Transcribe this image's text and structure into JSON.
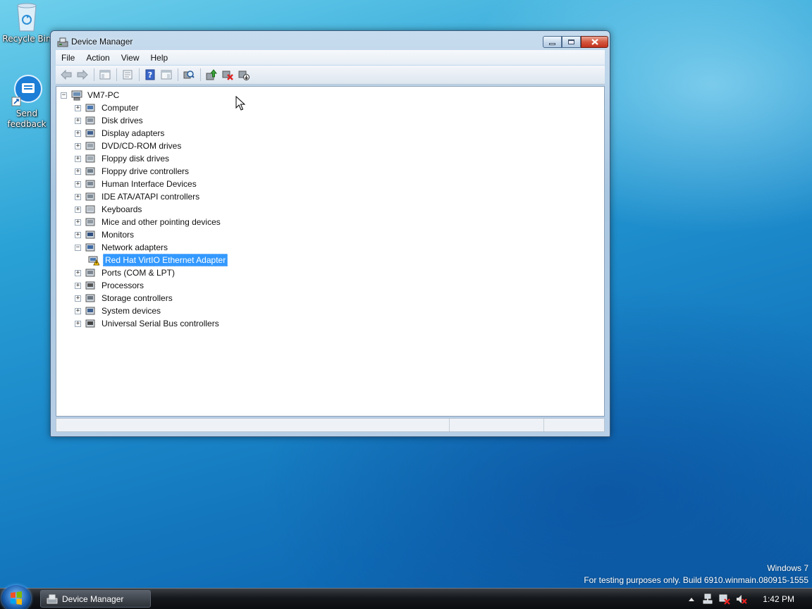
{
  "desktop": {
    "icons": [
      {
        "label": "Recycle Bin"
      },
      {
        "label": "Send feedback"
      }
    ],
    "watermark": {
      "line1": "Windows 7",
      "line2": "For testing purposes only. Build 6910.winmain.080915-1555"
    }
  },
  "window": {
    "title": "Device Manager",
    "menu": [
      "File",
      "Action",
      "View",
      "Help"
    ],
    "toolbar": [
      "back-icon",
      "forward-icon",
      "show-hide-tree-icon",
      "properties-icon",
      "help-icon",
      "show-hide-action-pane-icon",
      "scan-hardware-icon",
      "update-driver-icon",
      "uninstall-icon",
      "disable-device-icon"
    ],
    "tree": {
      "root": "VM7-PC",
      "items": [
        {
          "label": "Computer",
          "icon": "computer-icon",
          "expanded": false
        },
        {
          "label": "Disk drives",
          "icon": "disk-drive-icon",
          "expanded": false
        },
        {
          "label": "Display adapters",
          "icon": "display-adapter-icon",
          "expanded": false
        },
        {
          "label": "DVD/CD-ROM drives",
          "icon": "dvd-drive-icon",
          "expanded": false
        },
        {
          "label": "Floppy disk drives",
          "icon": "floppy-drive-icon",
          "expanded": false
        },
        {
          "label": "Floppy drive controllers",
          "icon": "floppy-controller-icon",
          "expanded": false
        },
        {
          "label": "Human Interface Devices",
          "icon": "hid-icon",
          "expanded": false
        },
        {
          "label": "IDE ATA/ATAPI controllers",
          "icon": "ide-controller-icon",
          "expanded": false
        },
        {
          "label": "Keyboards",
          "icon": "keyboard-icon",
          "expanded": false
        },
        {
          "label": "Mice and other pointing devices",
          "icon": "mouse-icon",
          "expanded": false
        },
        {
          "label": "Monitors",
          "icon": "monitor-icon",
          "expanded": false
        },
        {
          "label": "Network adapters",
          "icon": "network-adapter-icon",
          "expanded": true
        },
        {
          "label": "Red Hat VirtIO Ethernet Adapter",
          "icon": "warning-network-adapter-icon",
          "child": true,
          "selected": true
        },
        {
          "label": "Ports (COM & LPT)",
          "icon": "port-icon",
          "expanded": false
        },
        {
          "label": "Processors",
          "icon": "processor-icon",
          "expanded": false
        },
        {
          "label": "Storage controllers",
          "icon": "storage-controller-icon",
          "expanded": false
        },
        {
          "label": "System devices",
          "icon": "system-device-icon",
          "expanded": false
        },
        {
          "label": "Universal Serial Bus controllers",
          "icon": "usb-icon",
          "expanded": false
        }
      ]
    }
  },
  "taskbar": {
    "active_task": "Device Manager",
    "clock": "1:42 PM",
    "tray_icons": [
      "show-hidden-icons-icon",
      "network-icon",
      "action-center-icon",
      "volume-muted-icon"
    ]
  }
}
